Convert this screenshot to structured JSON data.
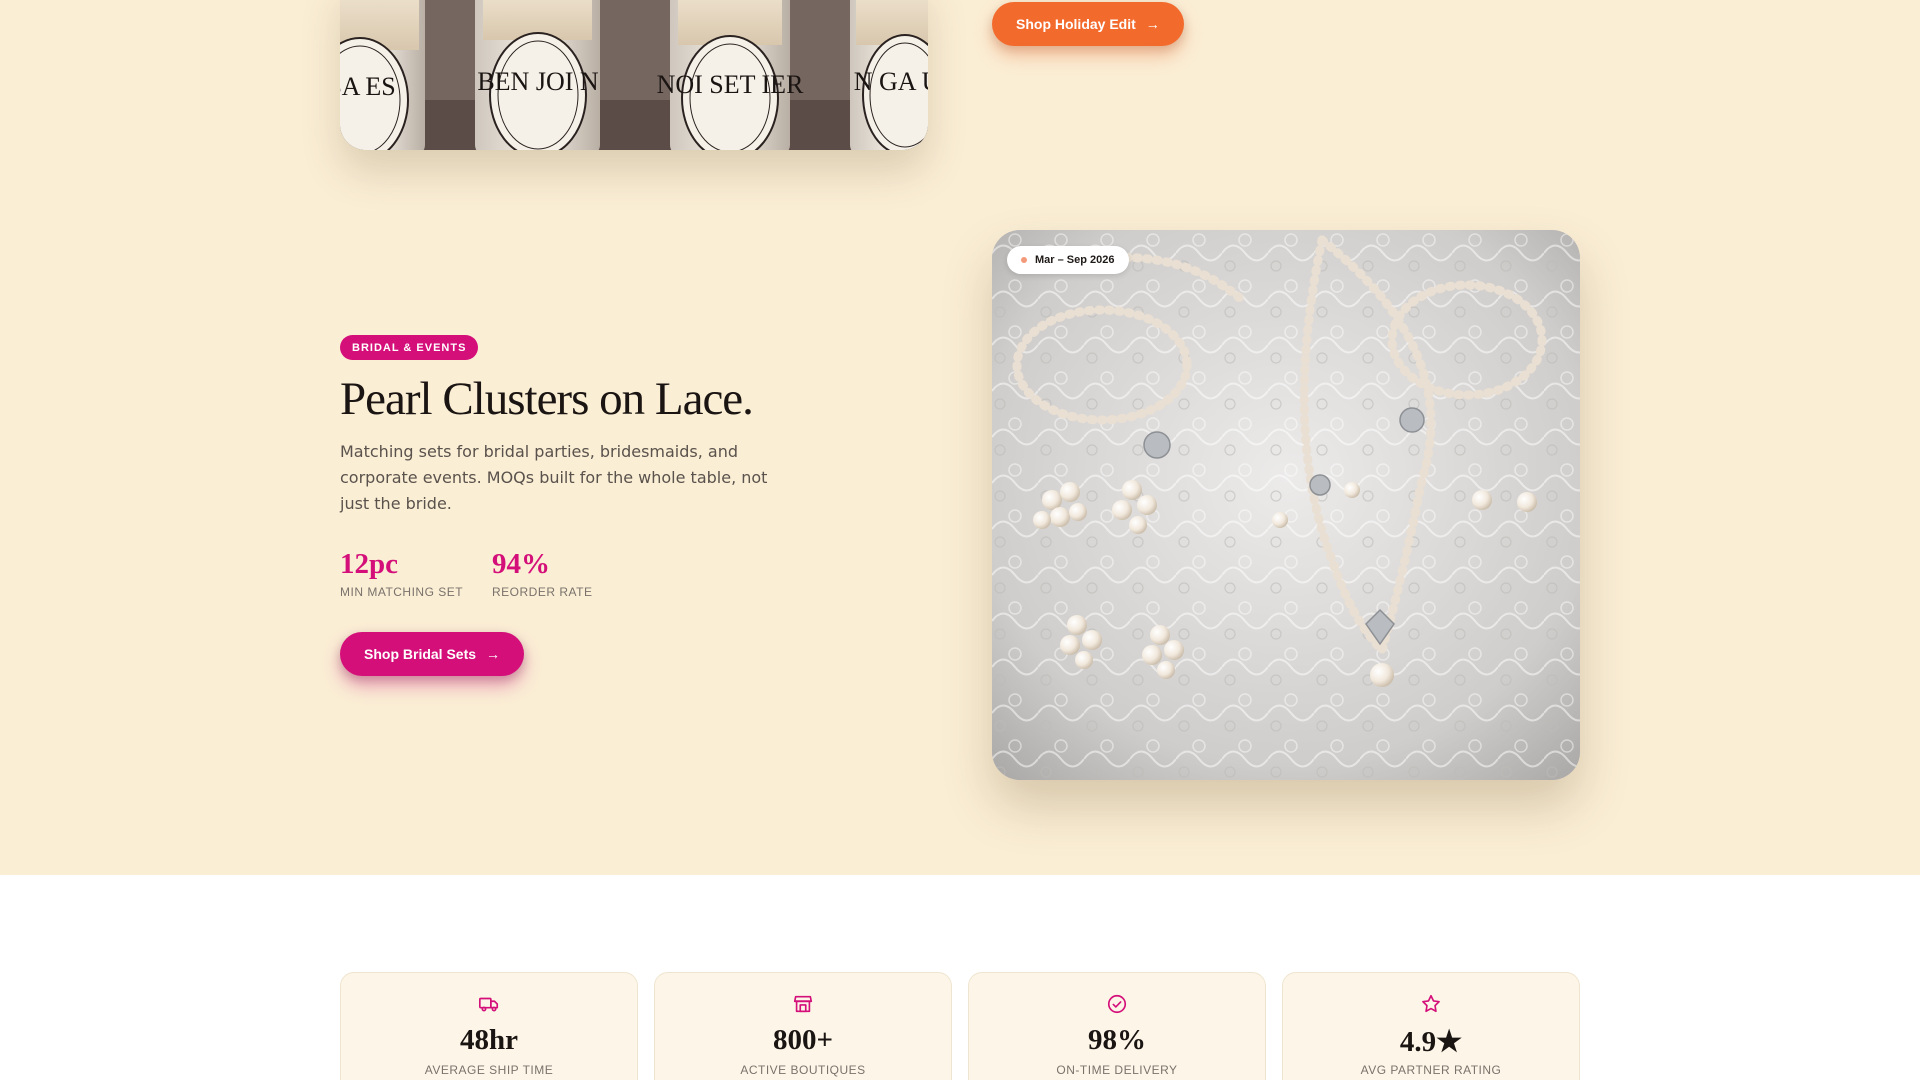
{
  "holiday": {
    "button_label": "Shop Holiday Edit",
    "arrow": "→",
    "image_labels": [
      "BA ES",
      "BEN JOI N",
      "NOI SET IER",
      "N GA UL"
    ]
  },
  "bridal": {
    "badge": "BRIDAL & EVENTS",
    "title": "Pearl Clusters on Lace.",
    "description": "Matching sets for bridal parties, bridesmaids, and corporate events. MOQs built for the whole table, not just the bride.",
    "stats": [
      {
        "value": "12pc",
        "label": "MIN MATCHING SET"
      },
      {
        "value": "94%",
        "label": "REORDER RATE"
      }
    ],
    "button_label": "Shop Bridal Sets",
    "arrow": "→",
    "date_chip": "Mar – Sep 2026"
  },
  "metrics": [
    {
      "icon": "truck-icon",
      "value": "48hr",
      "label": "AVERAGE SHIP TIME"
    },
    {
      "icon": "store-icon",
      "value": "800+",
      "label": "ACTIVE BOUTIQUES"
    },
    {
      "icon": "check-circle-icon",
      "value": "98%",
      "label": "ON-TIME DELIVERY"
    },
    {
      "icon": "star-icon",
      "value": "4.9★",
      "label": "AVG PARTNER RATING"
    }
  ],
  "colors": {
    "page_bg": "#faeed5",
    "holiday_accent": "#f36a2d",
    "bridal_accent": "#d40f7a",
    "card_bg": "#fdf6e8"
  }
}
